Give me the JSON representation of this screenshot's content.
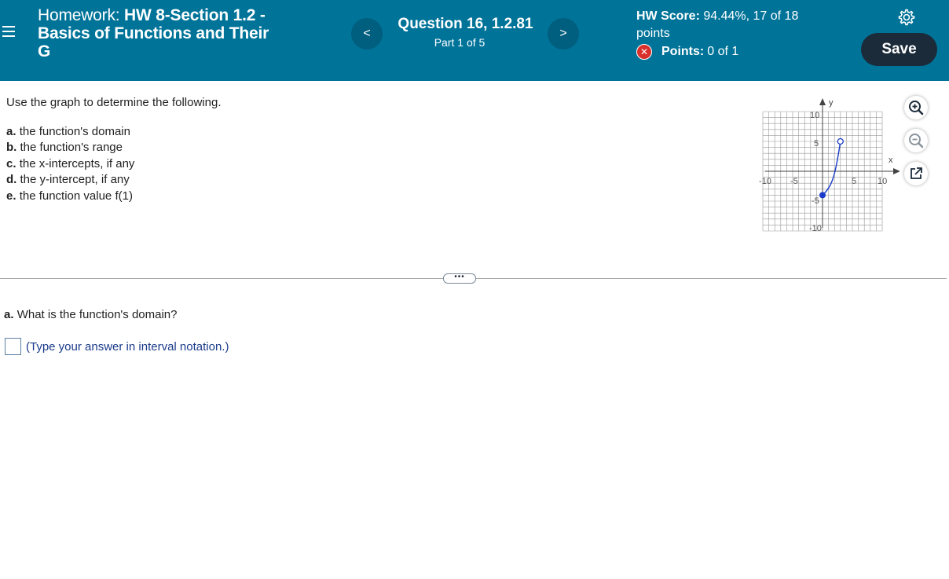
{
  "header": {
    "homework_label": "Homework: ",
    "homework_name_line1": "HW 8-Section 1.2 -",
    "homework_name_line2": "Basics of Functions and Their",
    "homework_name_line3": "G",
    "prev_label": "<",
    "next_label": ">",
    "question_title": "Question 16, 1.2.81",
    "question_part": "Part 1 of 5",
    "hw_score_label": "HW Score:",
    "hw_score_value": "94.44%, 17 of 18",
    "hw_score_suffix": "points",
    "points_label": "Points:",
    "points_value": "0 of 1",
    "save_label": "Save"
  },
  "question": {
    "intro": "Use the graph to determine the following.",
    "parts": [
      {
        "letter": "a.",
        "text": "the function's domain"
      },
      {
        "letter": "b.",
        "text": "the function's range"
      },
      {
        "letter": "c.",
        "text": "the x-intercepts, if any"
      },
      {
        "letter": "d.",
        "text": "the y-intercept, if any"
      },
      {
        "letter": "e.",
        "text": "the function value f(1)"
      }
    ]
  },
  "graph": {
    "y_axis_label": "y",
    "x_axis_label": "x",
    "tick_labels": {
      "x_neg10": "-10",
      "x_neg5": "-5",
      "x_5": "5",
      "x_10": "10",
      "y_10": "10",
      "y_5": "5",
      "y_neg5": "-5",
      "y_neg10": "-10"
    },
    "colors": {
      "curve": "#1a3cc8",
      "grid": "#999999"
    },
    "curve": {
      "start": {
        "x": 0,
        "y": -4,
        "closed": true
      },
      "end": {
        "x": 3,
        "y": 5,
        "closed": false
      }
    }
  },
  "answer": {
    "prompt_letter": "a.",
    "prompt_text": "What is the function's domain?",
    "hint": "(Type your answer in interval notation.)",
    "value": ""
  },
  "icons": [
    "menu-icon",
    "chevron-left-icon",
    "chevron-right-icon",
    "error-x-icon",
    "gear-icon",
    "zoom-in-icon",
    "zoom-out-icon",
    "popout-icon"
  ],
  "colors": {
    "header_bg": "#007399",
    "save_bg": "#1b2b3a",
    "error_red": "#d9302c"
  }
}
